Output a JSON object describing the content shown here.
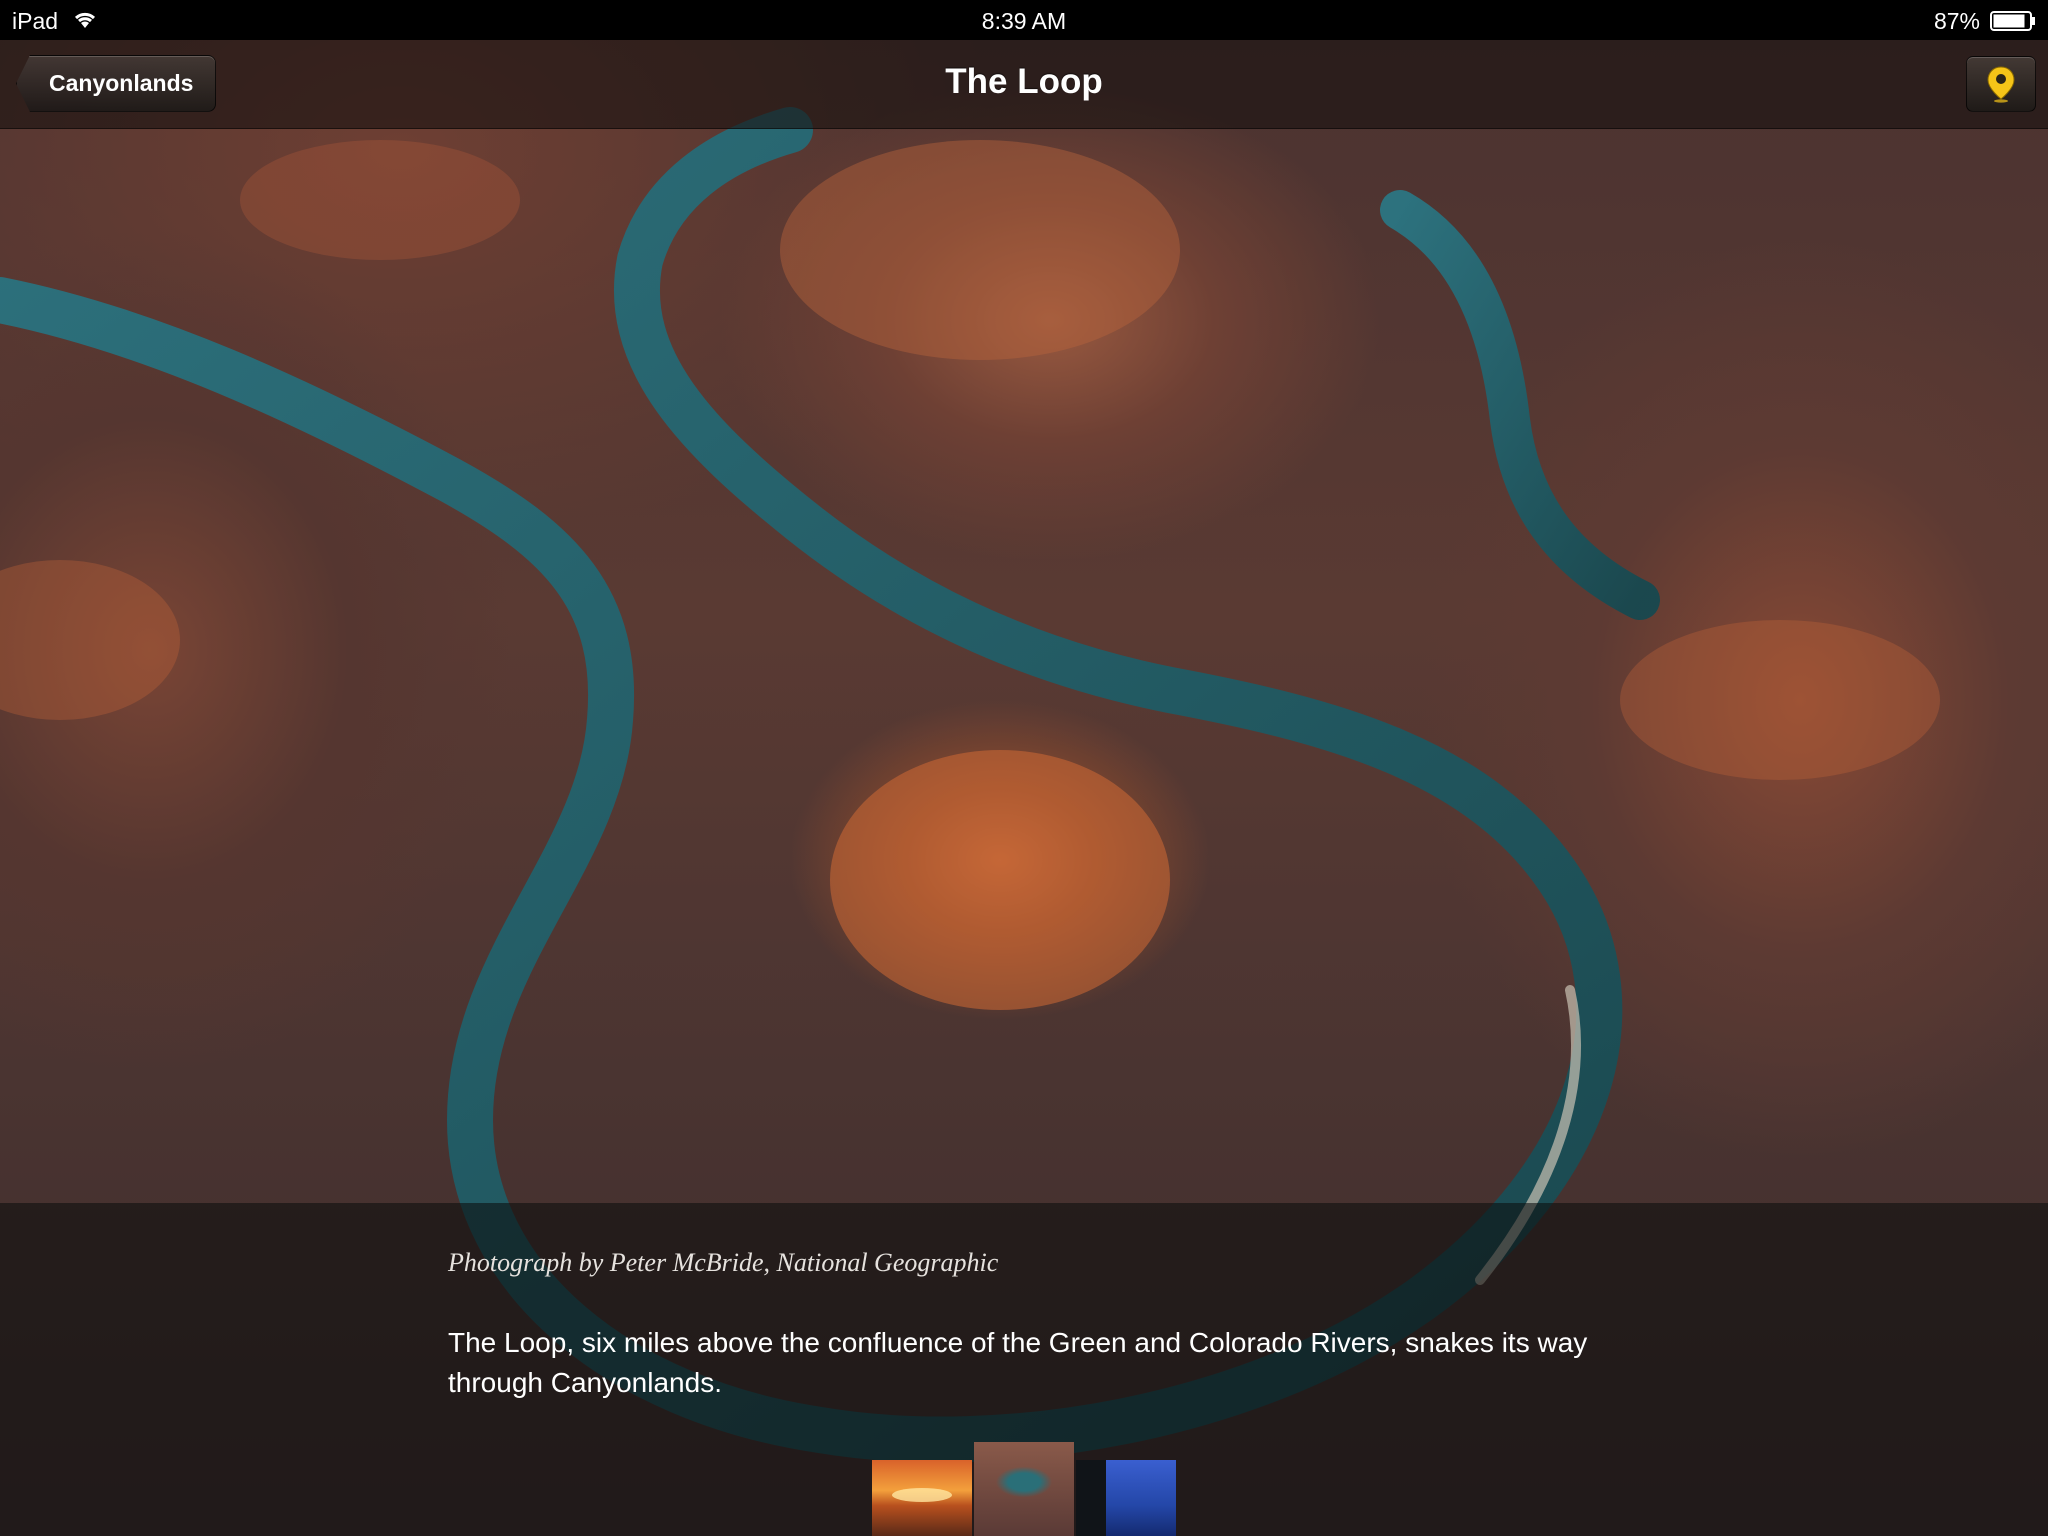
{
  "status_bar": {
    "device": "iPad",
    "time": "8:39 AM",
    "battery": "87%"
  },
  "nav": {
    "back_label": "Canyonlands",
    "title": "The Loop"
  },
  "caption": {
    "credit": "Photograph by Peter McBride, National Geographic",
    "description": "The Loop, six miles above the confluence of the Green and Colorado Rivers, snakes its way through Canyonlands."
  },
  "icons": {
    "wifi": "wifi-icon",
    "battery": "battery-icon",
    "map_pin": "map-pin-icon"
  },
  "colors": {
    "pin": "#f5c418",
    "river": "#1f5d66"
  },
  "thumbnails": [
    {
      "name": "canyon-sunrise-thumbnail",
      "selected": false
    },
    {
      "name": "the-loop-thumbnail",
      "selected": true
    },
    {
      "name": "night-sky-thumbnail",
      "selected": false
    }
  ]
}
